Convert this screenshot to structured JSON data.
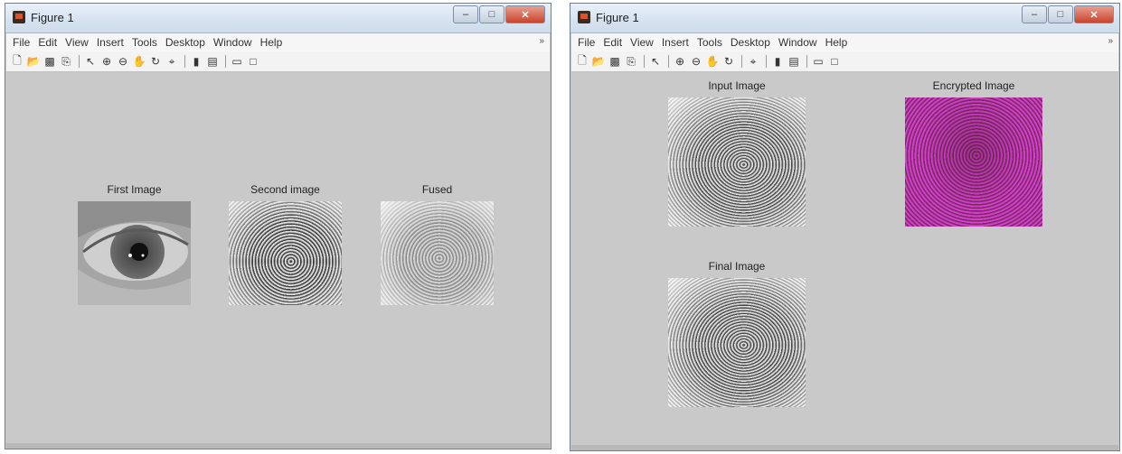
{
  "figure1": {
    "title": "Figure 1",
    "menu": [
      "File",
      "Edit",
      "View",
      "Insert",
      "Tools",
      "Desktop",
      "Window",
      "Help"
    ],
    "menu_arrow": "»",
    "toolbar_icons": [
      "new-file-icon",
      "open-folder-icon",
      "save-icon",
      "print-icon",
      "edit-plot-icon",
      "zoom-in-icon",
      "zoom-out-icon",
      "pan-icon",
      "rotate-icon",
      "data-cursor-icon",
      "colorbar-icon",
      "legend-icon",
      "hide-tools-icon",
      "show-tools-icon"
    ],
    "axes": [
      {
        "title": "First Image"
      },
      {
        "title": "Second image"
      },
      {
        "title": "Fused"
      }
    ]
  },
  "figure2": {
    "title": "Figure 1",
    "menu": [
      "File",
      "Edit",
      "View",
      "Insert",
      "Tools",
      "Desktop",
      "Window",
      "Help"
    ],
    "menu_arrow": "»",
    "toolbar_icons": [
      "new-file-icon",
      "open-folder-icon",
      "save-icon",
      "print-icon",
      "edit-plot-icon",
      "zoom-in-icon",
      "zoom-out-icon",
      "pan-icon",
      "rotate-icon",
      "data-cursor-icon",
      "colorbar-icon",
      "legend-icon",
      "hide-tools-icon",
      "show-tools-icon"
    ],
    "axes": [
      {
        "title": "Input Image"
      },
      {
        "title": "Encrypted Image"
      },
      {
        "title": "Final Image"
      }
    ]
  }
}
